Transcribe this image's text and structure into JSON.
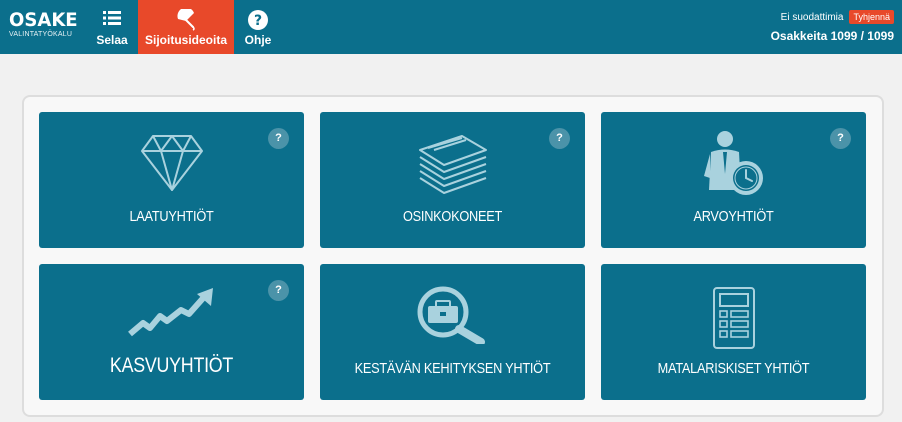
{
  "logo": {
    "main": "OSAKE",
    "sub": "VALINTATYÖKALU"
  },
  "nav": {
    "selaa": "Selaa",
    "ideat": "Sijoitusideoita",
    "ohje": "Ohje"
  },
  "filter": {
    "status": "Ei suodattimia",
    "clear": "Tyhjennä",
    "count": "Osakkeita 1099 / 1099"
  },
  "tiles": [
    {
      "label": "LAATUYHTIÖT",
      "icon": "diamond-icon",
      "help": "?"
    },
    {
      "label": "OSINKOKONEET",
      "icon": "paper-stack-icon",
      "help": "?"
    },
    {
      "label": "ARVOYHTIÖT",
      "icon": "businessman-clock-icon",
      "help": "?"
    },
    {
      "label": "KASVUYHTIÖT",
      "icon": "growth-arrow-icon",
      "help": "?"
    },
    {
      "label": "KESTÄVÄN KEHITYKSEN YHTIÖT",
      "icon": "magnifier-briefcase-icon"
    },
    {
      "label": "MATALARISKISET YHTIÖT",
      "icon": "calculator-icon"
    }
  ],
  "colors": {
    "primary": "#0b6f8c",
    "accent": "#e8492a",
    "icon": "#a9d2de"
  }
}
